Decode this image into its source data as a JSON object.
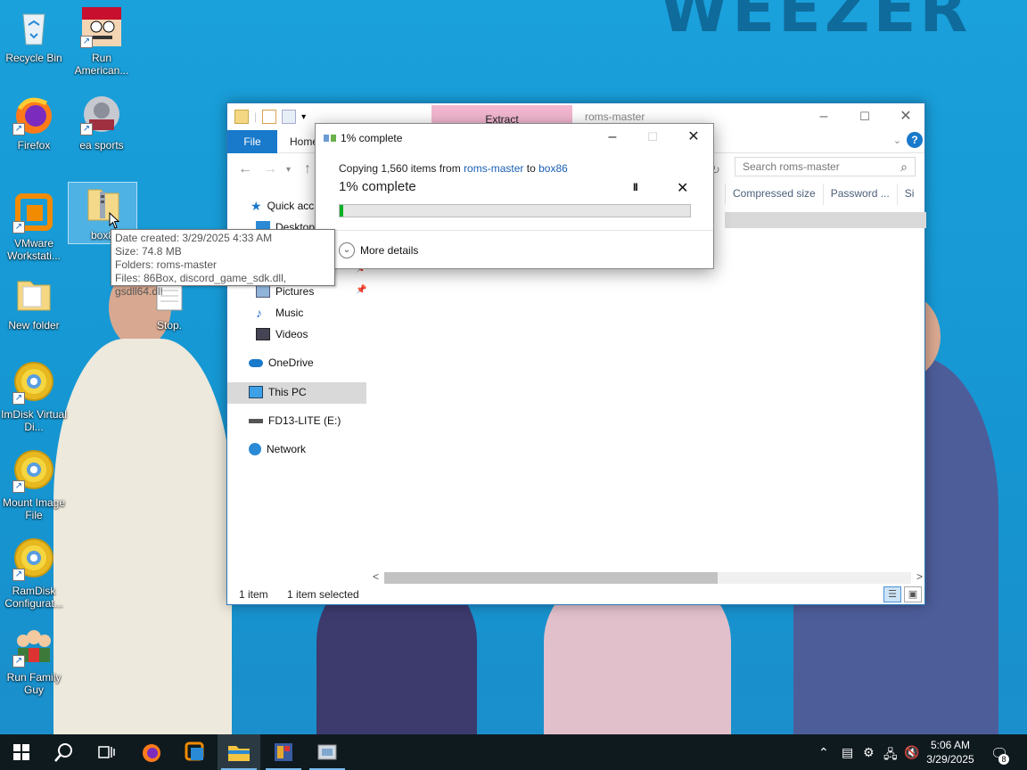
{
  "desktop": {
    "icons": [
      {
        "label": "Recycle Bin",
        "icon": "recycle-bin-icon"
      },
      {
        "label": "Run American...",
        "icon": "american-dad-icon"
      },
      {
        "label": "Firefox",
        "icon": "firefox-icon"
      },
      {
        "label": "ea sports",
        "icon": "ea-sports-icon"
      },
      {
        "label": "VMware Workstati...",
        "icon": "vmware-icon"
      },
      {
        "label": "box8",
        "icon": "zip-folder-icon"
      },
      {
        "label": "New folder",
        "icon": "folder-icon"
      },
      {
        "label": "Stop.",
        "icon": "text-file-icon"
      },
      {
        "label": "ImDisk Virtual Di...",
        "icon": "disc-icon"
      },
      {
        "label": "Mount Image File",
        "icon": "disc-icon"
      },
      {
        "label": "RamDisk Configurat...",
        "icon": "disc-icon"
      },
      {
        "label": "Run Family Guy",
        "icon": "family-guy-icon"
      }
    ]
  },
  "tooltip": {
    "line1": "Date created: 3/29/2025 4:33 AM",
    "line2": "Size: 74.8 MB",
    "line3": "Folders: roms-master",
    "line4": "Files: 86Box, discord_game_sdk.dll, gsdll64.dll"
  },
  "explorer": {
    "title": "roms-master",
    "extract_tab": "Extract",
    "ribbon": {
      "file": "File",
      "home": "Home"
    },
    "search_placeholder": "Search roms-master",
    "columns": [
      "Compressed size",
      "Password ...",
      "Si"
    ],
    "nav": {
      "quick_access": "Quick acc",
      "desktop": "Desktop",
      "pictures": "Pictures",
      "music": "Music",
      "videos": "Videos",
      "onedrive": "OneDrive",
      "this_pc": "This PC",
      "drive": "FD13-LITE (E:)",
      "network": "Network"
    },
    "status": {
      "items": "1 item",
      "selected": "1 item selected"
    }
  },
  "copy_dialog": {
    "title": "1% complete",
    "msg_prefix": "Copying 1,560 items from ",
    "source": "roms-master",
    "msg_mid": " to ",
    "dest": "box86",
    "percent_label": "1% complete",
    "progress": 0.01,
    "pause_label": "II",
    "more_details": "More details"
  },
  "taskbar": {
    "time": "5:06 AM",
    "date": "3/29/2025",
    "notifications": "8",
    "apps": [
      "start-icon",
      "search-icon",
      "task-view-icon",
      "firefox-icon",
      "vmware-icon",
      "file-explorer-icon",
      "app-icon",
      "app-icon"
    ]
  },
  "colors": {
    "accent": "#1979ca",
    "progress": "#06b025",
    "desktop": "#1d9bd6"
  }
}
